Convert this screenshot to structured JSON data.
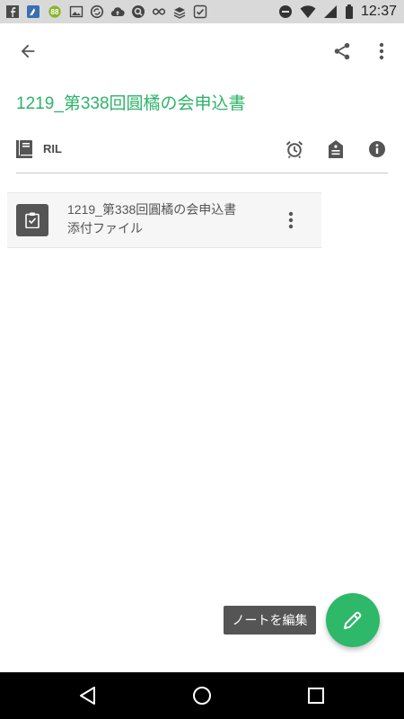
{
  "status_bar": {
    "time": "12:37",
    "left_icons": [
      "facebook-icon",
      "app-icon",
      "badge-88-icon",
      "image-icon",
      "sync-icon",
      "cloud-upload-icon",
      "search-app-icon",
      "infinity-icon",
      "stack-icon",
      "check-icon"
    ],
    "badge_text": "88",
    "right_icons": [
      "do-not-disturb-icon",
      "wifi-icon",
      "signal-icon",
      "battery-icon"
    ]
  },
  "toolbar": {
    "back_icon": "arrow-left-icon",
    "share_icon": "share-icon",
    "more_icon": "more-vertical-icon"
  },
  "note": {
    "title": "1219_第338回圓橘の会申込書",
    "notebook": "RIL",
    "meta_icons": [
      "alarm-icon",
      "tag-icon",
      "info-icon"
    ]
  },
  "attachment": {
    "name": "1219_第338回圓橘の会申込書",
    "subtitle": "添付ファイル",
    "thumb_icon": "clipboard-icon",
    "more_icon": "more-vertical-icon"
  },
  "fab": {
    "tooltip": "ノートを編集",
    "icon": "pencil-icon"
  },
  "nav_bar": {
    "icons": [
      "back-triangle-icon",
      "home-circle-icon",
      "recents-square-icon"
    ]
  },
  "colors": {
    "accent": "#2fb36a",
    "fab": "#2db86a",
    "status_bar_bg": "#d9d9d9",
    "nav_bar_bg": "#000000"
  }
}
